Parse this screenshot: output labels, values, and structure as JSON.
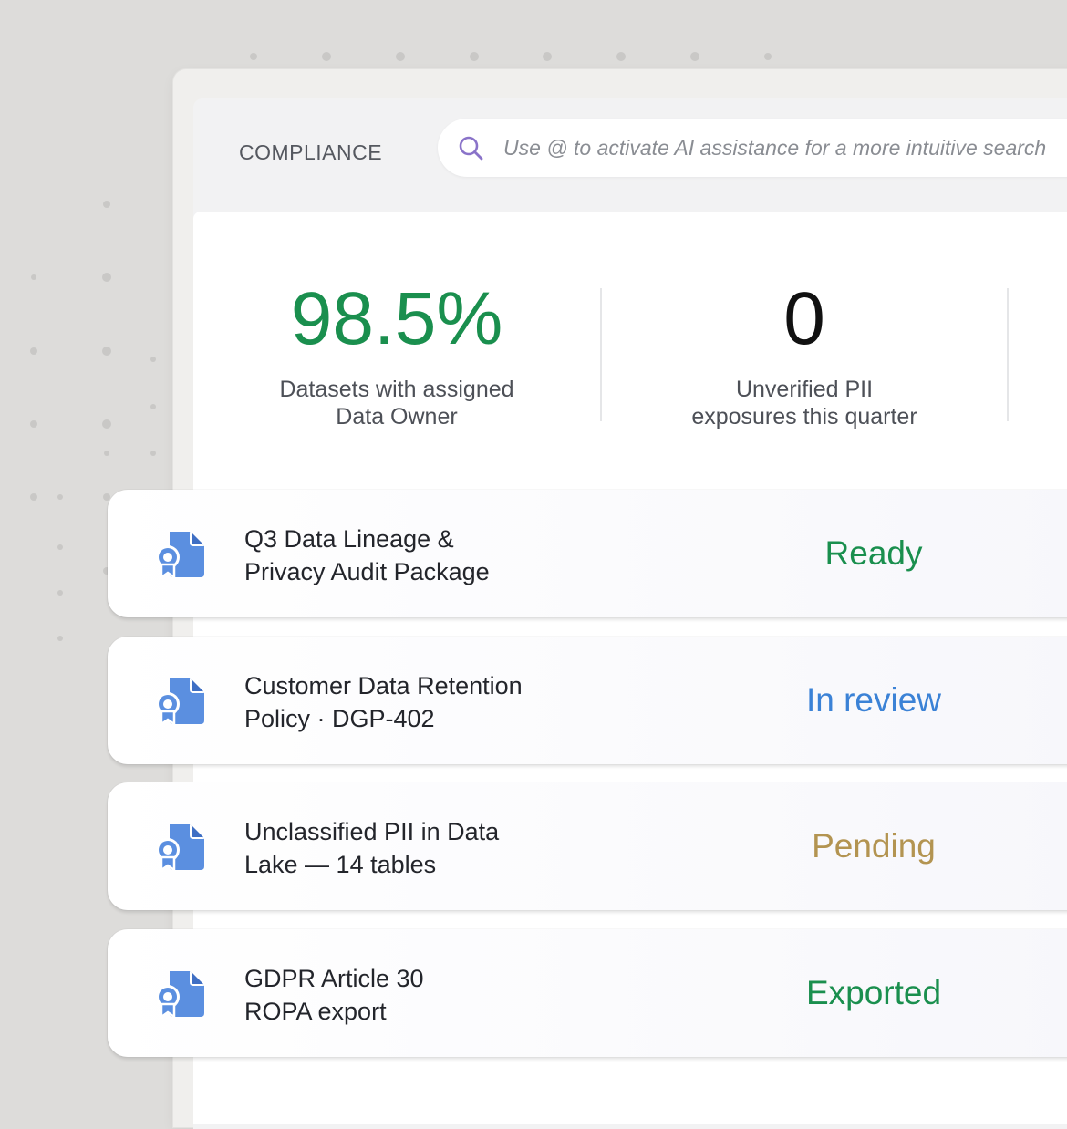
{
  "header": {
    "section_title": "COMPLIANCE",
    "search_placeholder": "Use @ to activate AI assistance for a more intuitive search"
  },
  "stats": [
    {
      "value": "98.5%",
      "label": "Datasets with assigned\nData Owner",
      "color": "#1a8f4e"
    },
    {
      "value": "0",
      "label": "Unverified PII\nexposures this quarter",
      "color": "#111111"
    }
  ],
  "items": [
    {
      "title": "Q3 Data Lineage &\nPrivacy Audit Package",
      "status": "Ready",
      "status_color": "#1a8f4e",
      "icon": "document-certificate-icon"
    },
    {
      "title": "Customer Data Retention\nPolicy · DGP-402",
      "status": "In review",
      "status_color": "#3b82d6",
      "icon": "document-certificate-icon"
    },
    {
      "title": "Unclassified PII in Data\nLake — 14 tables",
      "status": "Pending",
      "status_color": "#b39451",
      "icon": "document-certificate-icon"
    },
    {
      "title": "GDPR Article 30\nROPA export",
      "status": "Exported",
      "status_color": "#1a8f4e",
      "icon": "document-certificate-icon"
    }
  ],
  "colors": {
    "accent_blue": "#5b8fe0",
    "search_icon": "#8a73c9"
  }
}
